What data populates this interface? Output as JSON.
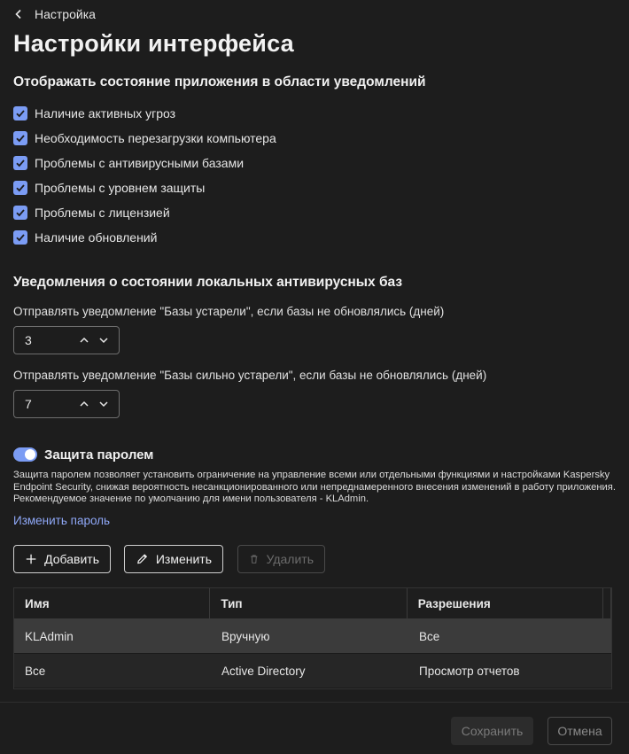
{
  "breadcrumb": {
    "back_label": "Настройка"
  },
  "page_title": "Настройки интерфейса",
  "tray_section": {
    "title": "Отображать состояние приложения в области уведомлений",
    "items": [
      {
        "label": "Наличие активных угроз",
        "checked": true
      },
      {
        "label": "Необходимость перезагрузки компьютера",
        "checked": true
      },
      {
        "label": "Проблемы с антивирусными базами",
        "checked": true
      },
      {
        "label": "Проблемы с уровнем защиты",
        "checked": true
      },
      {
        "label": "Проблемы с лицензией",
        "checked": true
      },
      {
        "label": "Наличие обновлений",
        "checked": true
      }
    ]
  },
  "db_section": {
    "title": "Уведомления о состоянии локальных антивирусных баз",
    "outdated_label": "Отправлять уведомление \"Базы устарели\", если базы не обновлялись (дней)",
    "outdated_value": "3",
    "very_outdated_label": "Отправлять уведомление \"Базы сильно устарели\", если базы не обновлялись (дней)",
    "very_outdated_value": "7"
  },
  "password_section": {
    "toggle_label": "Защита паролем",
    "toggle_on": true,
    "description": "Защита паролем позволяет установить ограничение на управление всеми или отдельными функциями и настройками Kaspersky Endpoint Security, снижая вероятность несанкционированного или непреднамеренного внесения изменений в работу приложения. Рекомендуемое значение по умолчанию для имени пользователя - KLAdmin.",
    "change_password_link": "Изменить пароль",
    "buttons": {
      "add": "Добавить",
      "edit": "Изменить",
      "delete": "Удалить"
    },
    "table": {
      "columns": [
        "Имя",
        "Тип",
        "Разрешения"
      ],
      "rows": [
        {
          "name": "KLAdmin",
          "type": "Вручную",
          "permissions": "Все",
          "selected": true
        },
        {
          "name": "Все",
          "type": "Active Directory",
          "permissions": "Просмотр отчетов",
          "selected": false
        }
      ]
    }
  },
  "footer": {
    "save": "Сохранить",
    "cancel": "Отмена"
  },
  "colors": {
    "accent": "#7b9cf4",
    "link": "#8fa8f7",
    "background": "#1d1d1d"
  }
}
